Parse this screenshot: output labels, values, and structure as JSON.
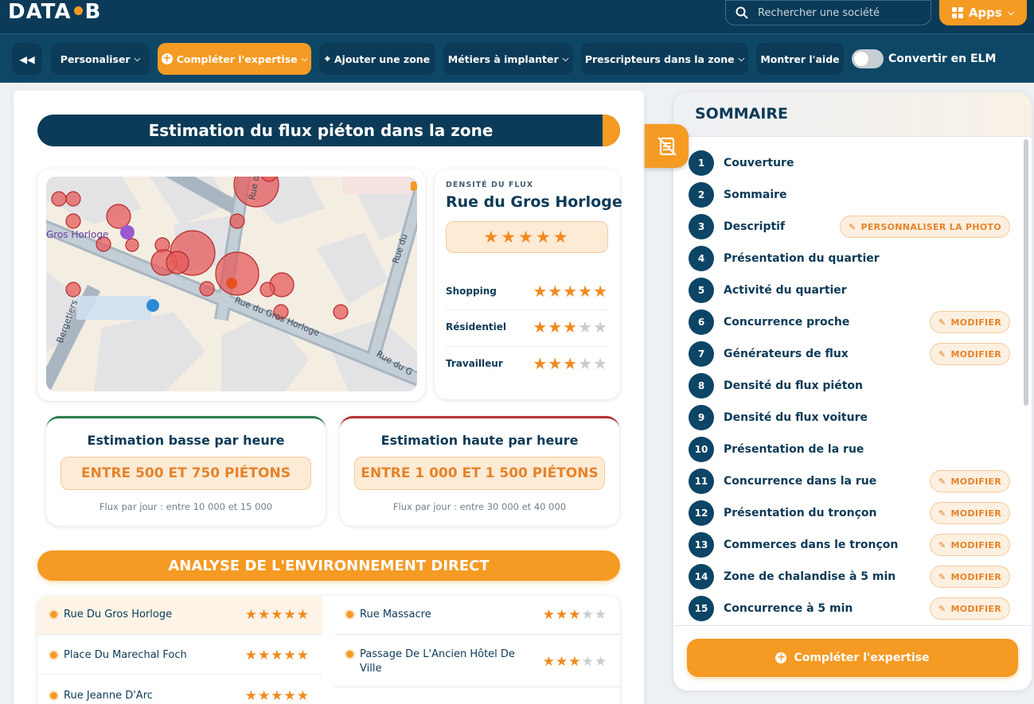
{
  "header": {
    "logo_left": "DATA",
    "logo_right": "B",
    "search_placeholder": "Rechercher une société",
    "apps_label": "Apps"
  },
  "toolbar": {
    "personaliser": "Personaliser",
    "completer": "Compléter l'expertise",
    "ajouter_zone": "Ajouter une zone",
    "metiers": "Métiers à implanter",
    "prescripteurs": "Prescripteurs dans la zone",
    "aide": "Montrer l'aide",
    "elm_label": "Convertir en ELM",
    "elm_on": false
  },
  "section_title": "Estimation du flux piéton dans la zone",
  "map": {
    "label_place": "Gros Horloge",
    "street_label": "Rue du Gros Horloge",
    "street_label_2": "Rue du G",
    "street_label_3": "Rue du",
    "street_label_4": "Rue du",
    "street_label_5": "Rue du G",
    "street_left": "Bergetiers"
  },
  "density": {
    "label": "DENSITÉ DU FLUX",
    "street": "Rue du Gros Horloge",
    "overall_rating": 5,
    "rows": [
      {
        "label": "Shopping",
        "rating": 5
      },
      {
        "label": "Résidentiel",
        "rating": 3
      },
      {
        "label": "Travailleur",
        "rating": 3
      }
    ]
  },
  "estimates": {
    "low": {
      "title": "Estimation basse par heure",
      "value": "ENTRE 500 ET 750 PIÉTONS",
      "sub": "Flux par jour : entre 10 000 et 15 000",
      "accent": "#2e7d4f"
    },
    "high": {
      "title": "Estimation haute par heure",
      "value": "ENTRE 1 000 ET 1 500 PIÉTONS",
      "sub": "Flux par jour : entre 30 000 et 40 000",
      "accent": "#b83232"
    }
  },
  "environment": {
    "title": "ANALYSE DE L'ENVIRONNEMENT DIRECT",
    "items": [
      {
        "name": "Rue Du Gros Horloge",
        "rating": 5
      },
      {
        "name": "Rue Massacre",
        "rating": 3
      },
      {
        "name": "Place Du Marechal Foch",
        "rating": 5
      },
      {
        "name": "Passage De L'Ancien Hôtel De Ville",
        "rating": 3
      },
      {
        "name": "Rue Jeanne D'Arc",
        "rating": 5
      }
    ]
  },
  "sidebar": {
    "title": "SOMMAIRE",
    "items": [
      {
        "num": "1",
        "label": "Couverture",
        "button": ""
      },
      {
        "num": "2",
        "label": "Sommaire",
        "button": ""
      },
      {
        "num": "3",
        "label": "Descriptif",
        "button": "PERSONNALISER LA PHOTO"
      },
      {
        "num": "4",
        "label": "Présentation du quartier",
        "button": ""
      },
      {
        "num": "5",
        "label": "Activité du quartier",
        "button": ""
      },
      {
        "num": "6",
        "label": "Concurrence proche",
        "button": "MODIFIER"
      },
      {
        "num": "7",
        "label": "Générateurs de flux",
        "button": "MODIFIER"
      },
      {
        "num": "8",
        "label": "Densité du flux piéton",
        "button": ""
      },
      {
        "num": "9",
        "label": "Densité du flux voiture",
        "button": ""
      },
      {
        "num": "10",
        "label": "Présentation de la rue",
        "button": ""
      },
      {
        "num": "11",
        "label": "Concurrence dans la rue",
        "button": "MODIFIER"
      },
      {
        "num": "12",
        "label": "Présentation du tronçon",
        "button": "MODIFIER"
      },
      {
        "num": "13",
        "label": "Commerces dans le tronçon",
        "button": "MODIFIER"
      },
      {
        "num": "14",
        "label": "Zone de chalandise à 5 min",
        "button": "MODIFIER"
      },
      {
        "num": "15",
        "label": "Concurrence à 5 min",
        "button": "MODIFIER"
      }
    ],
    "complete_label": "Compléter l'expertise"
  },
  "colors": {
    "navy": "#0b3b58",
    "orange": "#f59a23",
    "star_on": "#f08a1f",
    "star_off": "#c8cdd2"
  }
}
